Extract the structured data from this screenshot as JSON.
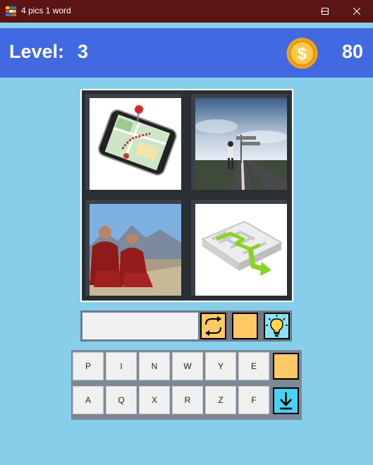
{
  "window": {
    "title": "4 pics 1 word"
  },
  "header": {
    "level_label": "Level:",
    "level_value": "3",
    "coins": "80"
  },
  "board": {
    "pictures": [
      "smartphone-map-icon",
      "crossroads-signpost-icon",
      "monks-mountains-icon",
      "green-maze-arrow-icon"
    ]
  },
  "answer": {
    "value": ""
  },
  "keyboard": {
    "row1": [
      "P",
      "I",
      "N",
      "W",
      "Y",
      "E"
    ],
    "row2": [
      "A",
      "Q",
      "X",
      "R",
      "Z",
      "F"
    ]
  },
  "colors": {
    "title_bar": "#5C1414",
    "header": "#4169E1",
    "background": "#87CEEB",
    "button_yellow": "#FFC966",
    "button_cyan": "#48D1F0"
  }
}
